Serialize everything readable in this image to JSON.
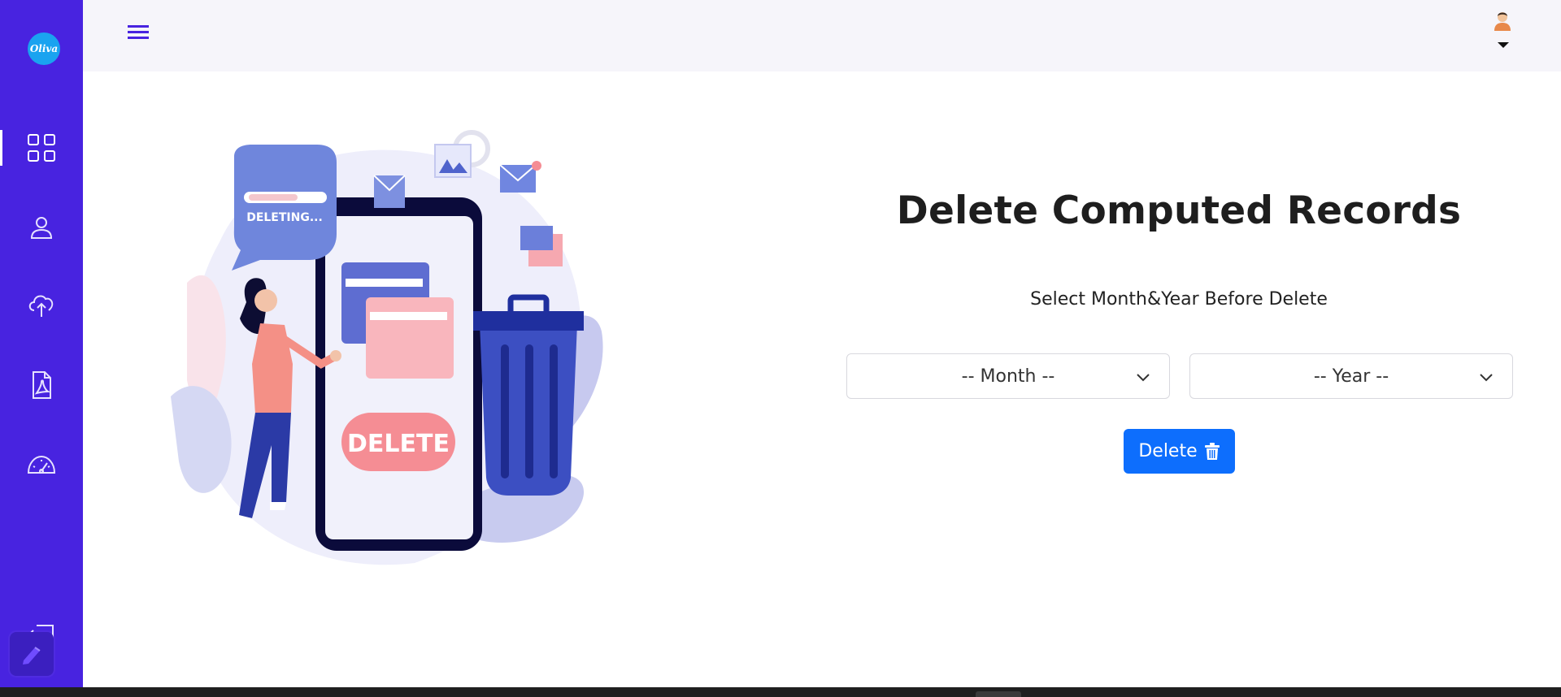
{
  "app": {
    "logo_text": "Oliva"
  },
  "sidebar": {
    "items": [
      {
        "icon": "dashboard-grid-icon",
        "active": true
      },
      {
        "icon": "user-icon",
        "active": false
      },
      {
        "icon": "cloud-upload-icon",
        "active": false
      },
      {
        "icon": "pdf-file-icon",
        "active": false
      },
      {
        "icon": "speedometer-icon",
        "active": false
      },
      {
        "icon": "logout-icon",
        "active": false
      }
    ]
  },
  "illustration": {
    "bubble_text": "DELETING...",
    "phone_button_text": "DELETE"
  },
  "main": {
    "title": "Delete Computed Records",
    "subtitle": "Select Month&Year Before Delete",
    "month_select": {
      "selected": "-- Month --"
    },
    "year_select": {
      "selected": "-- Year --"
    },
    "delete_button": {
      "label": "Delete",
      "icon": "trash-icon"
    }
  },
  "colors": {
    "sidebar": "#4823e0",
    "topbar": "#f6f5fa",
    "primary_button": "#0d6efd",
    "logo": "#1aa3f0"
  }
}
